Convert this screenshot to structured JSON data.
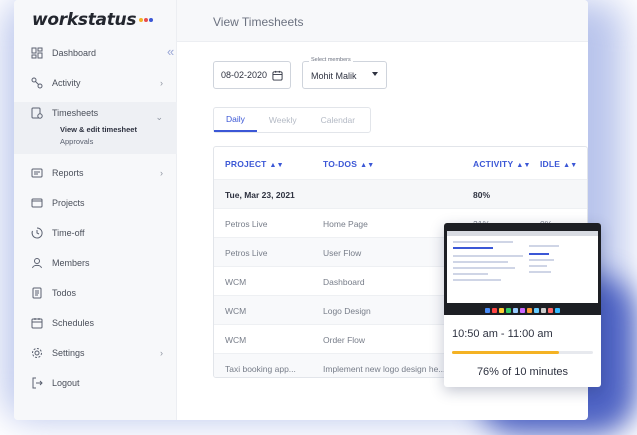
{
  "app": {
    "logo_text": "workstatus",
    "logo_dot_colors": [
      "#f4b223",
      "#e84d4d",
      "#3b57d6"
    ],
    "page_title": "View Timesheets"
  },
  "sidebar": {
    "items": [
      {
        "label": "Dashboard",
        "icon": "dashboard-icon"
      },
      {
        "label": "Activity",
        "icon": "activity-icon",
        "has_chevron": true
      },
      {
        "label": "Timesheets",
        "icon": "timesheet-icon",
        "expanded": true,
        "children": [
          {
            "label": "View & edit timesheet",
            "active": true
          },
          {
            "label": "Approvals"
          }
        ]
      },
      {
        "label": "Reports",
        "icon": "reports-icon",
        "has_chevron": true
      },
      {
        "label": "Projects",
        "icon": "projects-icon"
      },
      {
        "label": "Time-off",
        "icon": "timeoff-icon"
      },
      {
        "label": "Members",
        "icon": "members-icon"
      },
      {
        "label": "Todos",
        "icon": "todos-icon"
      },
      {
        "label": "Schedules",
        "icon": "schedules-icon"
      },
      {
        "label": "Settings",
        "icon": "settings-icon",
        "has_chevron": true
      },
      {
        "label": "Logout",
        "icon": "logout-icon"
      }
    ]
  },
  "filters": {
    "date_value": "08-02-2020",
    "members_label": "Select members",
    "members_value": "Mohit Malik"
  },
  "tabs": [
    {
      "label": "Daily",
      "active": true
    },
    {
      "label": "Weekly"
    },
    {
      "label": "Calendar"
    }
  ],
  "table": {
    "headers": [
      "PROJECT",
      "TO-DOS",
      "ACTIVITY",
      "IDLE"
    ],
    "date_row": {
      "date": "Tue, Mar 23, 2021",
      "activity": "80%"
    },
    "rows": [
      {
        "project": "Petros Live",
        "todo": "Home Page",
        "activity": "21%",
        "idle": "0%"
      },
      {
        "project": "Petros Live",
        "todo": "User Flow",
        "activity": "",
        "idle": ""
      },
      {
        "project": "WCM",
        "todo": "Dashboard",
        "activity": "",
        "idle": ""
      },
      {
        "project": "WCM",
        "todo": "Logo Design",
        "activity": "",
        "idle": ""
      },
      {
        "project": "WCM",
        "todo": "Order Flow",
        "activity": "",
        "idle": ""
      },
      {
        "project": "Taxi booking app...",
        "todo": "Implement new logo design he...",
        "activity": "",
        "idle": ""
      }
    ]
  },
  "screenshot_card": {
    "time_range": "10:50 am - 11:00 am",
    "progress_fraction": 0.76,
    "progress_text": "76% of 10 minutes",
    "progress_color": "#f4b223"
  }
}
